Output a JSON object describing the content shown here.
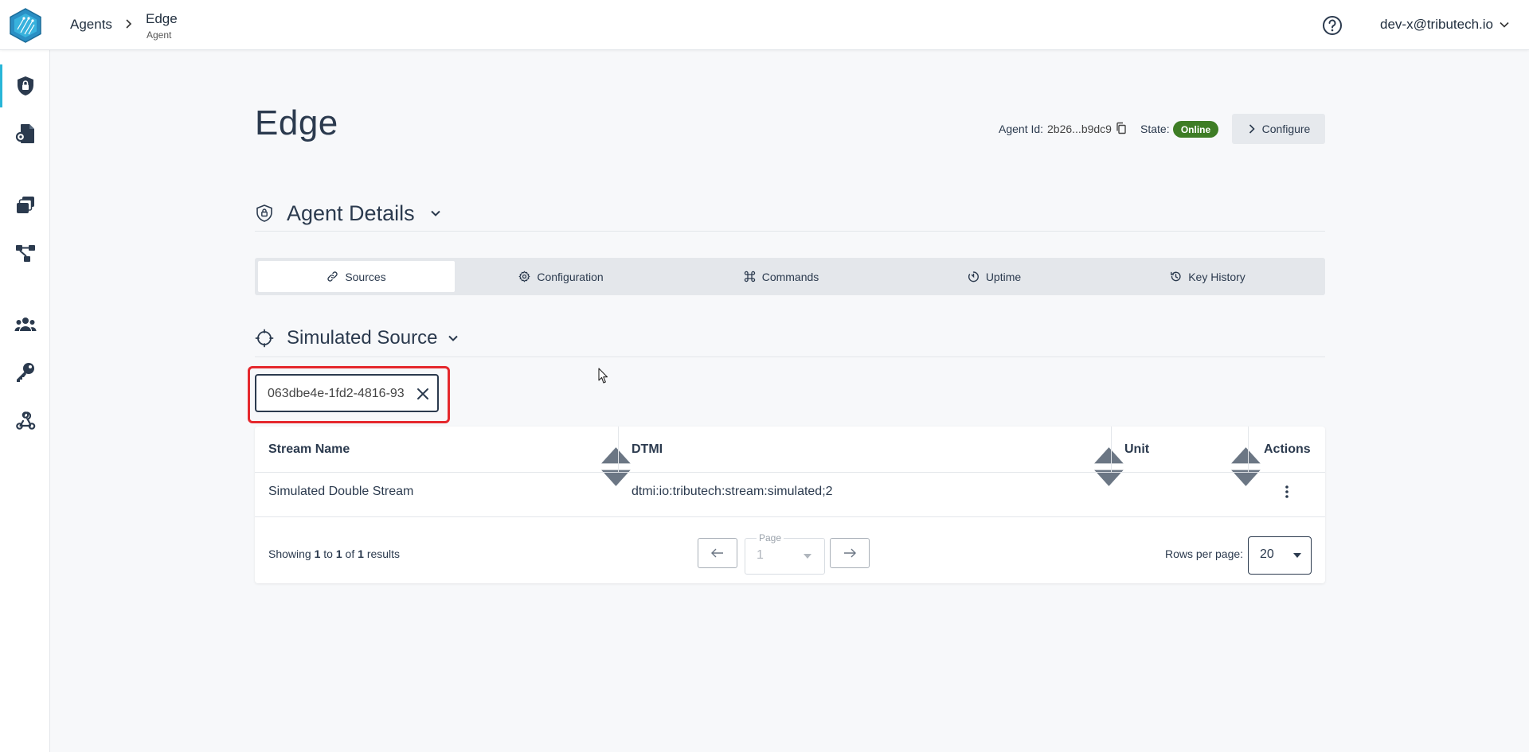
{
  "header": {
    "breadcrumb_root": "Agents",
    "breadcrumb_current": "Edge",
    "breadcrumb_sub": "Agent",
    "user_email": "dev-x@tributech.io",
    "logo_icon": "tributech-logo-icon",
    "help_icon": "help-circle-icon"
  },
  "sidebar": {
    "items": [
      {
        "icon": "shield-lock-icon",
        "active": true
      },
      {
        "icon": "document-key-icon",
        "active": false
      },
      {
        "icon": "stack-icon",
        "active": false
      },
      {
        "icon": "network-nodes-icon",
        "active": false
      },
      {
        "icon": "users-icon",
        "active": false
      },
      {
        "icon": "key-icon",
        "active": false
      },
      {
        "icon": "webhook-icon",
        "active": false
      }
    ],
    "theme_icon": "sun-icon"
  },
  "page": {
    "title": "Edge",
    "agent_id_label": "Agent Id:",
    "agent_id_value": "2b26...b9dc9",
    "state_label": "State:",
    "state_value": "Online",
    "configure_label": "Configure"
  },
  "agent_details": {
    "title": "Agent Details"
  },
  "tabs": [
    {
      "label": "Sources",
      "icon": "link-icon",
      "active": true
    },
    {
      "label": "Configuration",
      "icon": "gear-icon",
      "active": false
    },
    {
      "label": "Commands",
      "icon": "command-icon",
      "active": false
    },
    {
      "label": "Uptime",
      "icon": "timer-icon",
      "active": false
    },
    {
      "label": "Key History",
      "icon": "history-icon",
      "active": false
    }
  ],
  "source": {
    "title": "Simulated Source",
    "filter_chip": "063dbe4e-1fd2-4816-93"
  },
  "table": {
    "columns": [
      "Stream Name",
      "DTMI",
      "Unit",
      "Actions"
    ],
    "rows": [
      {
        "stream_name": "Simulated Double Stream",
        "dtmi": "dtmi:io:tributech:stream:simulated;2",
        "unit": ""
      }
    ],
    "showing_prefix": "Showing",
    "showing_from": "1",
    "showing_to_word": "to",
    "showing_to": "1",
    "showing_of_word": "of",
    "showing_total": "1",
    "showing_suffix": "results",
    "page_label": "Page",
    "page_value": "1",
    "rows_per_page_label": "Rows per page:",
    "rows_per_page_value": "20"
  },
  "colors": {
    "accent": "#29b6d8",
    "online": "#3e7d25",
    "highlight": "#e5282d",
    "text": "#2b3a4e"
  }
}
